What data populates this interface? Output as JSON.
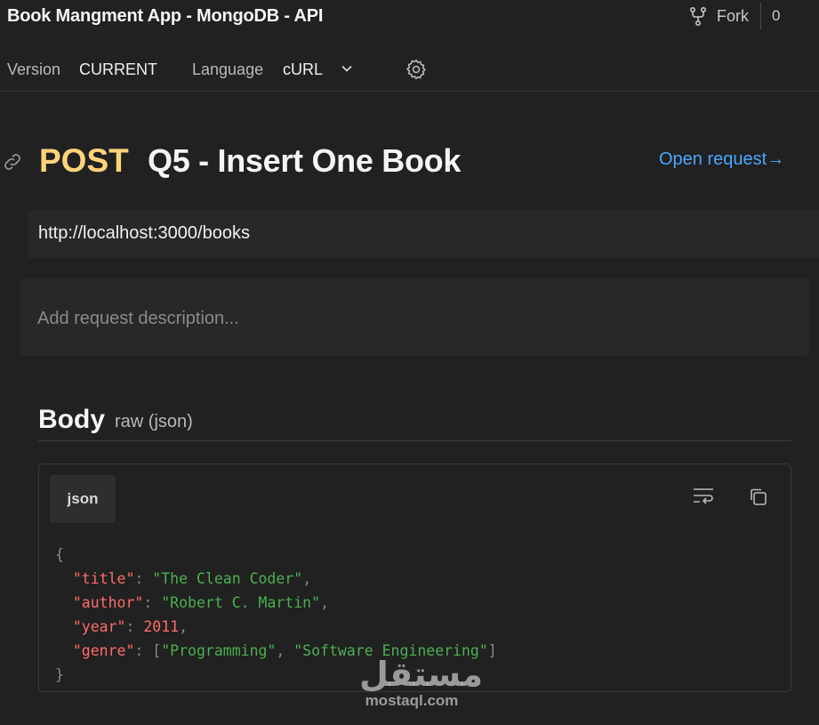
{
  "header": {
    "app_title": "Book Mangment App - MongoDB - API",
    "fork_label": "Fork",
    "fork_count": "0"
  },
  "subbar": {
    "version_label": "Version",
    "version_value": "CURRENT",
    "language_label": "Language",
    "language_value": "cURL"
  },
  "request": {
    "method": "POST",
    "title": "Q5 - Insert One Book",
    "open_request_label": "Open request→",
    "url": "http://localhost:3000/books",
    "description_placeholder": "Add request description..."
  },
  "body_section": {
    "heading": "Body",
    "mode": "raw (json)",
    "language_tab": "json",
    "code": {
      "open_brace": "{",
      "close_brace": "}",
      "title_key": "\"title\"",
      "title_value": "\"The Clean Coder\"",
      "author_key": "\"author\"",
      "author_value": "\"Robert C. Martin\"",
      "year_key": "\"year\"",
      "year_value": "2011",
      "genre_key": "\"genre\"",
      "genre_value_1": "\"Programming\"",
      "genre_value_2": "\"Software Engineering\""
    }
  },
  "watermark": {
    "arabic": "مستقل",
    "latin": "mostaql.com"
  },
  "colors": {
    "background": "#212121",
    "method_post": "#ffd37a",
    "link_blue": "#4aa6ff",
    "json_key": "#ff6b6b",
    "json_string": "#4caf50"
  },
  "icons": [
    "fork-icon",
    "chevron-down-icon",
    "gear-icon",
    "link-icon",
    "wrap-lines-icon",
    "copy-icon"
  ]
}
